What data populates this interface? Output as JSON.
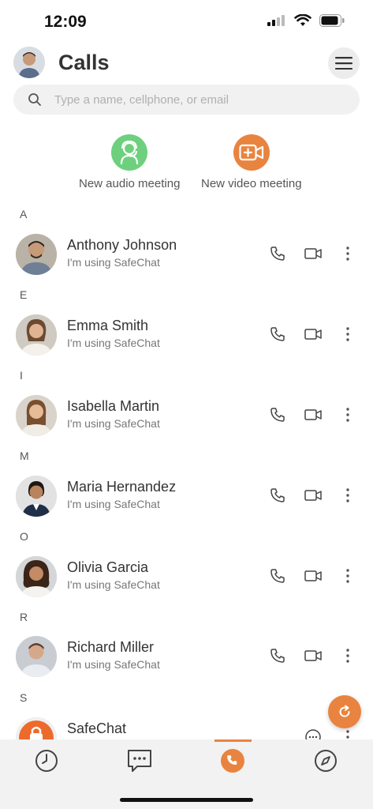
{
  "status_bar": {
    "time": "12:09"
  },
  "header": {
    "title": "Calls"
  },
  "search": {
    "placeholder": "Type a name, cellphone, or email"
  },
  "meetings": {
    "audio_label": "New audio meeting",
    "video_label": "New video meeting"
  },
  "sections": [
    "A",
    "E",
    "I",
    "M",
    "O",
    "R",
    "S"
  ],
  "contacts": [
    {
      "name": "Anthony Johnson",
      "status": "I'm using SafeChat"
    },
    {
      "name": "Emma Smith",
      "status": "I'm using SafeChat"
    },
    {
      "name": "Isabella Martin",
      "status": "I'm using SafeChat"
    },
    {
      "name": "Maria Hernandez",
      "status": "I'm using SafeChat"
    },
    {
      "name": "Olivia Garcia",
      "status": "I'm using SafeChat"
    },
    {
      "name": "Richard Miller",
      "status": "I'm using SafeChat"
    },
    {
      "name": "SafeChat"
    }
  ],
  "tabs": [
    "history-icon",
    "chat-icon",
    "phone-icon",
    "compass-icon"
  ],
  "colors": {
    "accent": "#e8843f",
    "audio_green": "#6ed07e",
    "video_orange": "#e8843f"
  }
}
